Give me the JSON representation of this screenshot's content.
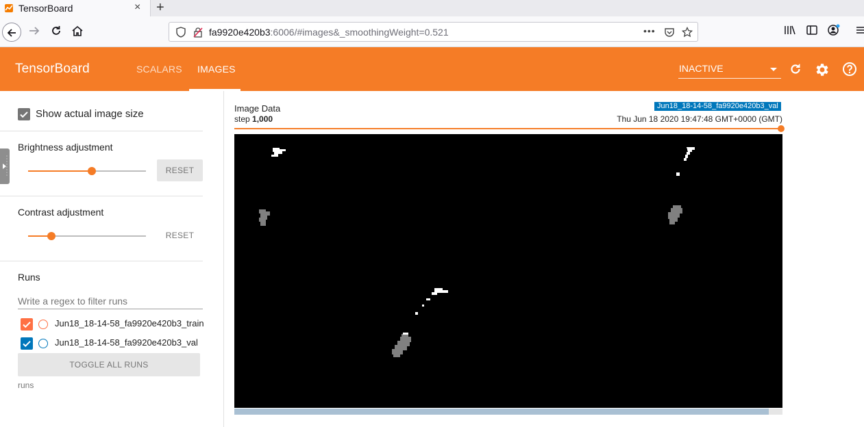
{
  "browser": {
    "tab_title": "TensorBoard",
    "new_tab_label": "+",
    "tab_close_label": "×",
    "url_host": "fa9920e420b3",
    "url_rest": ":6006/#images&_smoothingWeight=0.521",
    "url_more_label": "•••"
  },
  "header": {
    "brand": "TensorBoard",
    "tabs": [
      {
        "label": "SCALARS"
      },
      {
        "label": "IMAGES"
      }
    ],
    "reload_select_value": "INACTIVE",
    "accent_color": "#f57c26"
  },
  "sidebar": {
    "show_actual_size_label": "Show actual image size",
    "show_actual_size_checked": true,
    "brightness": {
      "title": "Brightness adjustment",
      "reset_label": "RESET",
      "value_fraction": 0.54
    },
    "contrast": {
      "title": "Contrast adjustment",
      "reset_label": "RESET",
      "value_fraction": 0.2
    },
    "runs": {
      "title": "Runs",
      "filter_placeholder": "Write a regex to filter runs",
      "items": [
        {
          "label": "Jun18_18-14-58_fa9920e420b3_train",
          "checked": true,
          "color": "#ff7043"
        },
        {
          "label": "Jun18_18-14-58_fa9920e420b3_val",
          "checked": true,
          "color": "#0077bb"
        }
      ],
      "toggle_all_label": "TOGGLE ALL RUNS",
      "footer_label": "runs"
    }
  },
  "image_card": {
    "title": "Image Data",
    "step_prefix": "step ",
    "step_value": "1,000",
    "run_tag": "Jun18_18-14-58_fa9920e420b3_val",
    "date": "Thu Jun 18 2020 19:47:48 GMT+0000 (GMT)",
    "step_slider_fraction": 1.0
  }
}
